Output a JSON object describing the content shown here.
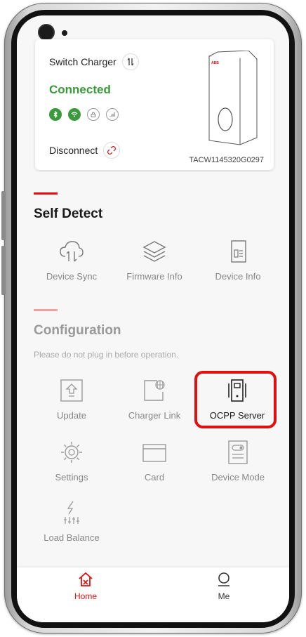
{
  "charger": {
    "switch_label": "Switch Charger",
    "status": "Connected",
    "disconnect_label": "Disconnect",
    "serial": "TACW1145320G0297",
    "brand_mark": "ABB",
    "status_icons": [
      "bluetooth-icon",
      "wifi-icon",
      "lock-icon",
      "signal-icon"
    ]
  },
  "self_detect": {
    "title": "Self Detect",
    "items": [
      {
        "label": "Device Sync",
        "icon": "cloud-sync-icon"
      },
      {
        "label": "Firmware Info",
        "icon": "layers-icon"
      },
      {
        "label": "Device Info",
        "icon": "document-icon"
      }
    ]
  },
  "configuration": {
    "title": "Configuration",
    "notice": "Please do not plug in before operation.",
    "items": [
      {
        "label": "Update",
        "icon": "update-icon"
      },
      {
        "label": "Charger Link",
        "icon": "globe-link-icon"
      },
      {
        "label": "OCPP Server",
        "icon": "server-icon"
      },
      {
        "label": "Settings",
        "icon": "gear-icon"
      },
      {
        "label": "Card",
        "icon": "card-icon"
      },
      {
        "label": "Device Mode",
        "icon": "device-mode-icon"
      },
      {
        "label": "Load Balance",
        "icon": "load-balance-icon"
      }
    ]
  },
  "tabs": [
    {
      "label": "Home",
      "icon": "home-icon",
      "active": true
    },
    {
      "label": "Me",
      "icon": "person-icon",
      "active": false
    }
  ],
  "colors": {
    "accent": "#e01010",
    "connected": "#3a9a3a",
    "muted_label": "#888888"
  }
}
